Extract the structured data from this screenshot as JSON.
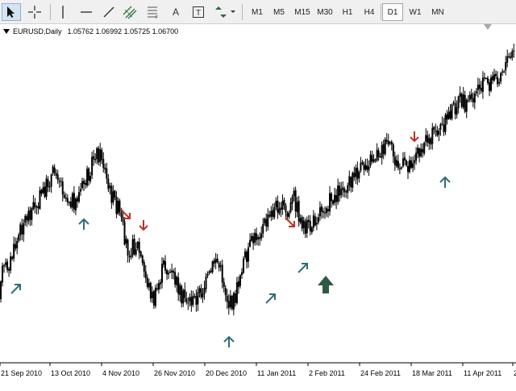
{
  "toolbar": {
    "tools": [
      {
        "name": "cursor-icon",
        "active": true
      },
      {
        "name": "crosshair-icon"
      },
      {
        "name": "vertical-line-icon"
      },
      {
        "name": "horizontal-line-icon"
      },
      {
        "name": "trendline-icon"
      },
      {
        "name": "equidistant-channel-icon"
      },
      {
        "name": "fibonacci-retracement-icon"
      },
      {
        "name": "text-tool-icon",
        "label": "A"
      },
      {
        "name": "text-label-icon",
        "label": "T"
      },
      {
        "name": "arrows-tool-icon"
      }
    ],
    "timeframes": [
      "M1",
      "M5",
      "M15",
      "M30",
      "H1",
      "H4",
      "D1",
      "W1",
      "MN"
    ],
    "active_timeframe": "D1"
  },
  "chart": {
    "symbol": "EURUSD,Daily",
    "ohlc": "1.05762 1.06992 1.05725 1.06700",
    "date_labels": [
      "21 Sep 2010",
      "13 Oct 2010",
      "4 Nov 2010",
      "26 Nov 2010",
      "20 Dec 2010",
      "11 Jan 2011",
      "2 Feb 2011",
      "24 Feb 2011",
      "18 Mar 2011",
      "11 Apr 2011",
      "2"
    ],
    "colors": {
      "candle": "#000000",
      "sell_arrow": "#c03020",
      "buy_arrow": "#2e6e78",
      "big_buy_arrow": "#2e5a44",
      "background": "#ffffff"
    }
  },
  "chart_data": {
    "type": "candlestick",
    "title": "EURUSD,Daily",
    "xlabel": "",
    "ylabel": "",
    "grid": false,
    "last_bar": {
      "open": 1.05762,
      "high": 1.06992,
      "low": 1.05725,
      "close": 1.067
    },
    "x_ticks": [
      "21 Sep 2010",
      "13 Oct 2010",
      "4 Nov 2010",
      "26 Nov 2010",
      "20 Dec 2010",
      "11 Jan 2011",
      "2 Feb 2011",
      "24 Feb 2011",
      "18 Mar 2011",
      "11 Apr 2011"
    ],
    "signals": [
      {
        "type": "buy",
        "date": "17 Sep 2010"
      },
      {
        "type": "buy",
        "date": "15 Oct 2010"
      },
      {
        "type": "sell",
        "date": "29 Oct 2010"
      },
      {
        "type": "sell",
        "date": "4 Nov 2010"
      },
      {
        "type": "buy",
        "date": "16 Dec 2010"
      },
      {
        "type": "buy",
        "date": "7 Jan 2011"
      },
      {
        "type": "sell",
        "date": "24 Jan 2011"
      },
      {
        "type": "buy",
        "date": "28 Jan 2011"
      },
      {
        "type": "strong-buy",
        "date": "3 Feb 2011"
      },
      {
        "type": "sell",
        "date": "18 Mar 2011"
      },
      {
        "type": "buy",
        "date": "28 Mar 2011"
      }
    ]
  }
}
